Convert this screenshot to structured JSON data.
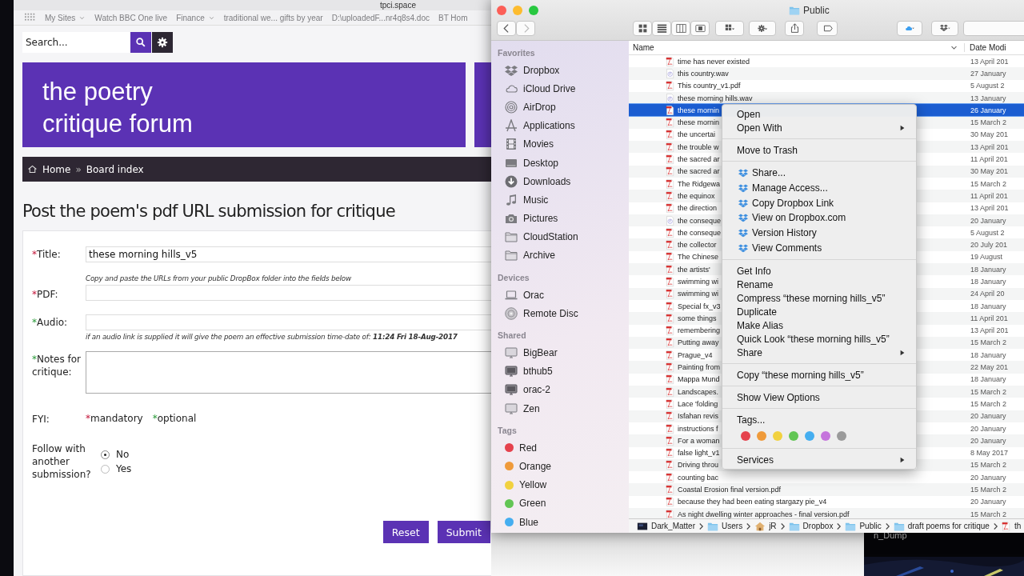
{
  "browser": {
    "address": "tpci.space",
    "bookmarks": [
      {
        "label": "My Sites",
        "menu": true
      },
      {
        "label": "Watch BBC One live",
        "menu": false
      },
      {
        "label": "Finance",
        "menu": true
      },
      {
        "label": "traditional we... gifts by year",
        "menu": false
      },
      {
        "label": "D:\\uploadedF...nr4q8s4.doc",
        "menu": false
      },
      {
        "label": "BT Hom",
        "menu": false
      }
    ],
    "search": {
      "placeholder": "Search..."
    },
    "banner": {
      "title_line_1": "the poetry",
      "title_line_2": "critique forum"
    },
    "breadcrumb": [
      {
        "label": "Home"
      },
      {
        "label": "Board index"
      }
    ],
    "breadcrumb_separator": "»",
    "heading": "Post the poem's pdf URL submission for critique",
    "fields": [
      {
        "mark": "*",
        "required": true,
        "label": "Title:",
        "kind": "input",
        "value": "these morning hills_v5"
      },
      {
        "mark": "*",
        "required": true,
        "label": "PDF:",
        "kind": "input",
        "hint_above": "Copy and paste the URLs from your public DropBox folder into the fields below"
      },
      {
        "mark": "*",
        "required": false,
        "label": "Audio:",
        "kind": "input",
        "hint_below": "if an audio link is supplied it will give the poem an effective submission time-date of: **11:24 Fri 18-Aug-2017**"
      },
      {
        "mark": "*",
        "required": false,
        "label": "Notes for critique:",
        "kind": "textarea"
      }
    ],
    "fyi": {
      "label": "FYI:",
      "legend": [
        {
          "mark": "*",
          "required": true,
          "text": "mandatory"
        },
        {
          "mark": "*",
          "required": false,
          "text": "optional"
        }
      ]
    },
    "follow": {
      "label": "Follow with another submission?",
      "options": [
        {
          "label": "No",
          "selected": true
        },
        {
          "label": "Yes",
          "selected": false
        }
      ]
    },
    "buttons": [
      "Reset",
      "Submit"
    ]
  },
  "finder": {
    "title": "Public",
    "sidebar": [
      {
        "heading": "Favorites",
        "items": [
          {
            "label": "Dropbox"
          },
          {
            "label": "iCloud Drive"
          },
          {
            "label": "AirDrop"
          },
          {
            "label": "Applications"
          },
          {
            "label": "Movies"
          },
          {
            "label": "Desktop"
          },
          {
            "label": "Downloads"
          },
          {
            "label": "Music"
          },
          {
            "label": "Pictures"
          },
          {
            "label": "CloudStation"
          },
          {
            "label": "Archive"
          }
        ]
      },
      {
        "heading": "Devices",
        "items": [
          {
            "label": "Orac"
          },
          {
            "label": "Remote Disc"
          }
        ]
      },
      {
        "heading": "Shared",
        "items": [
          {
            "label": "BigBear"
          },
          {
            "label": "bthub5"
          },
          {
            "label": "orac-2"
          },
          {
            "label": "Zen"
          }
        ]
      },
      {
        "heading": "Tags",
        "items": [
          {
            "label": "Red",
            "color": "#e5424d"
          },
          {
            "label": "Orange",
            "color": "#ef9a3a"
          },
          {
            "label": "Yellow",
            "color": "#f1d13f"
          },
          {
            "label": "Green",
            "color": "#62c554"
          },
          {
            "label": "Blue",
            "color": "#45aef0"
          }
        ]
      }
    ],
    "columns": [
      "Name",
      "Date Modi"
    ],
    "files": [
      {
        "name": "time has never existed",
        "kind": "pdf",
        "date": "13 April 201",
        "selected": false
      },
      {
        "name": "this country.wav",
        "kind": "audio",
        "date": "27 January",
        "selected": false
      },
      {
        "name": "This country_v1.pdf",
        "kind": "pdf",
        "date": "5 August 2",
        "selected": false
      },
      {
        "name": "these morning hills.wav",
        "kind": "audio",
        "date": "13 January",
        "selected": false
      },
      {
        "name": "these mornin",
        "kind": "pdf",
        "date": "26 January",
        "selected": true
      },
      {
        "name": "these mornin",
        "kind": "pdf",
        "date": "15 March 2",
        "selected": false
      },
      {
        "name": "the uncertai",
        "kind": "pdf",
        "date": "30 May 201",
        "selected": false
      },
      {
        "name": "the trouble w",
        "kind": "pdf",
        "date": "13 April 201",
        "selected": false
      },
      {
        "name": "the sacred ar",
        "kind": "pdf",
        "date": "11 April 201",
        "selected": false
      },
      {
        "name": "the sacred ar",
        "kind": "pdf",
        "date": "30 May 201",
        "selected": false
      },
      {
        "name": "The Ridgewa",
        "kind": "pdf",
        "date": "15 March 2",
        "selected": false
      },
      {
        "name": "the equinox",
        "kind": "pdf",
        "date": "11 April 201",
        "selected": false
      },
      {
        "name": "the direction",
        "kind": "pdf",
        "date": "13 April 201",
        "selected": false
      },
      {
        "name": "the conseque",
        "kind": "audio",
        "date": "20 January",
        "selected": false
      },
      {
        "name": "the conseque",
        "kind": "pdf",
        "date": "5 August 2",
        "selected": false
      },
      {
        "name": "the collector",
        "kind": "pdf",
        "date": "20 July 201",
        "selected": false
      },
      {
        "name": "The Chinese",
        "kind": "pdf",
        "date": "19 August",
        "selected": false
      },
      {
        "name": "the artists'",
        "kind": "pdf",
        "date": "18 January",
        "selected": false
      },
      {
        "name": "swimming wi",
        "kind": "pdf",
        "date": "18 January",
        "selected": false
      },
      {
        "name": "swimming wi",
        "kind": "pdf",
        "date": "24 April 20",
        "selected": false
      },
      {
        "name": "Special fx_v3",
        "kind": "pdf",
        "date": "18 January",
        "selected": false
      },
      {
        "name": "some things",
        "kind": "pdf",
        "date": "11 April 201",
        "selected": false
      },
      {
        "name": "remembering",
        "kind": "pdf",
        "date": "13 April 201",
        "selected": false
      },
      {
        "name": "Putting away",
        "kind": "pdf",
        "date": "15 March 2",
        "selected": false
      },
      {
        "name": "Prague_v4",
        "kind": "pdf",
        "date": "18 January",
        "selected": false
      },
      {
        "name": "Painting from",
        "kind": "pdf",
        "date": "22 May 201",
        "selected": false
      },
      {
        "name": "Mappa Mund",
        "kind": "pdf",
        "date": "18 January",
        "selected": false
      },
      {
        "name": "Landscapes.",
        "kind": "pdf",
        "date": "15 March 2",
        "selected": false
      },
      {
        "name": "Lace 'folding",
        "kind": "pdf",
        "date": "15 March 2",
        "selected": false
      },
      {
        "name": "Isfahan revis",
        "kind": "pdf",
        "date": "20 January",
        "selected": false
      },
      {
        "name": "instructions f",
        "kind": "pdf",
        "date": "20 January",
        "selected": false
      },
      {
        "name": "For a woman",
        "kind": "pdf",
        "date": "20 January",
        "selected": false
      },
      {
        "name": "false light_v1",
        "kind": "pdf",
        "date": "8 May 2017",
        "selected": false
      },
      {
        "name": "Driving throu",
        "kind": "pdf",
        "date": "15 March 2",
        "selected": false
      },
      {
        "name": "counting bac",
        "kind": "pdf",
        "date": "20 January",
        "selected": false
      },
      {
        "name": "Coastal Erosion final version.pdf",
        "kind": "pdf",
        "date": "15 March 2",
        "selected": false
      },
      {
        "name": "because they had been eating stargazy pie_v4",
        "kind": "pdf",
        "date": "20 January",
        "selected": false
      },
      {
        "name": "As night dwelling winter approaches - final version.pdf",
        "kind": "pdf",
        "date": "15 March 2",
        "selected": false
      }
    ],
    "path": [
      {
        "label": "Dark_Matter",
        "kind": "drive"
      },
      {
        "label": "Users",
        "kind": "folder"
      },
      {
        "label": "jR",
        "kind": "home"
      },
      {
        "label": "Dropbox",
        "kind": "folder"
      },
      {
        "label": "Public",
        "kind": "folder"
      },
      {
        "label": "draft poems for critique",
        "kind": "folder"
      },
      {
        "label": "th",
        "kind": "pdf"
      }
    ]
  },
  "context_menu": {
    "sections": [
      {
        "items": [
          {
            "label": "Open",
            "has_icon": false,
            "submenu": false
          },
          {
            "label": "Open With",
            "has_icon": false,
            "submenu": true
          }
        ]
      },
      {
        "items": [
          {
            "label": "Move to Trash",
            "has_icon": false,
            "submenu": false
          }
        ]
      },
      {
        "items": [
          {
            "label": "Share...",
            "has_icon": true,
            "submenu": false
          },
          {
            "label": "Manage Access...",
            "has_icon": true,
            "submenu": false
          },
          {
            "label": "Copy Dropbox Link",
            "has_icon": true,
            "submenu": false
          },
          {
            "label": "View on Dropbox.com",
            "has_icon": true,
            "submenu": false
          },
          {
            "label": "Version History",
            "has_icon": true,
            "submenu": false
          },
          {
            "label": "View Comments",
            "has_icon": true,
            "submenu": false
          }
        ]
      },
      {
        "items": [
          {
            "label": "Get Info",
            "has_icon": false,
            "submenu": false
          },
          {
            "label": "Rename",
            "has_icon": false,
            "submenu": false
          },
          {
            "label": "Compress “these morning hills_v5”",
            "has_icon": false,
            "submenu": false
          },
          {
            "label": "Duplicate",
            "has_icon": false,
            "submenu": false
          },
          {
            "label": "Make Alias",
            "has_icon": false,
            "submenu": false
          },
          {
            "label": "Quick Look “these morning hills_v5”",
            "has_icon": false,
            "submenu": false
          },
          {
            "label": "Share",
            "has_icon": false,
            "submenu": true
          }
        ]
      },
      {
        "items": [
          {
            "label": "Copy “these morning hills_v5”",
            "has_icon": false,
            "submenu": false
          }
        ]
      },
      {
        "items": [
          {
            "label": "Show View Options",
            "has_icon": false,
            "submenu": false
          }
        ]
      },
      {
        "items": [
          {
            "label": "Tags...",
            "has_icon": false,
            "submenu": false
          }
        ],
        "tags": [
          {
            "color": "#e5424d"
          },
          {
            "color": "#ef9a3a"
          },
          {
            "color": "#f1d13f"
          },
          {
            "color": "#62c554"
          },
          {
            "color": "#45aef0"
          },
          {
            "color": "#c575dc"
          },
          {
            "color": "#9a9a9a"
          }
        ]
      },
      {
        "items": [
          {
            "label": "Services",
            "has_icon": false,
            "submenu": true
          }
        ]
      }
    ]
  },
  "desktop": {
    "icon_label": "n_Dump"
  }
}
